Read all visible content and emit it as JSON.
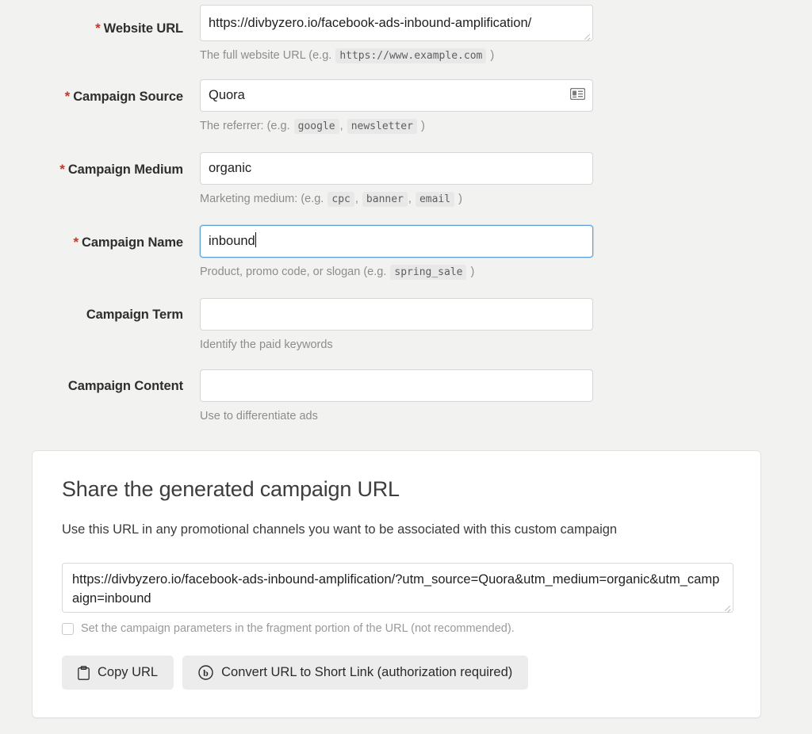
{
  "form": {
    "fields": [
      {
        "id": "website-url",
        "label": "Website URL",
        "required": true,
        "value": "https://divbyzero.io/facebook-ads-inbound-amplification/",
        "help_prefix": "The full website URL (e.g.",
        "help_chips": [
          "https://www.example.com"
        ],
        "help_suffix": ")"
      },
      {
        "id": "campaign-source",
        "label": "Campaign Source",
        "required": true,
        "value": "Quora",
        "help_prefix": "The referrer: (e.g.",
        "help_chips": [
          "google",
          "newsletter"
        ],
        "help_suffix": ")",
        "icon": "contact-card-icon"
      },
      {
        "id": "campaign-medium",
        "label": "Campaign Medium",
        "required": true,
        "value": "organic",
        "help_prefix": "Marketing medium: (e.g.",
        "help_chips": [
          "cpc",
          "banner",
          "email"
        ],
        "help_suffix": ")"
      },
      {
        "id": "campaign-name",
        "label": "Campaign Name",
        "required": true,
        "value": "inbound",
        "focused": true,
        "help_prefix": "Product, promo code, or slogan (e.g.",
        "help_chips": [
          "spring_sale"
        ],
        "help_suffix": ")"
      },
      {
        "id": "campaign-term",
        "label": "Campaign Term",
        "required": false,
        "value": "",
        "help_prefix": "Identify the paid keywords",
        "help_chips": [],
        "help_suffix": ""
      },
      {
        "id": "campaign-content",
        "label": "Campaign Content",
        "required": false,
        "value": "",
        "help_prefix": "Use to differentiate ads",
        "help_chips": [],
        "help_suffix": ""
      }
    ],
    "required_marker": "*"
  },
  "share_card": {
    "title": "Share the generated campaign URL",
    "subtitle": "Use this URL in any promotional channels you want to be associated with this custom campaign",
    "generated_url": "https://divbyzero.io/facebook-ads-inbound-amplification/?utm_source=Quora&utm_medium=organic&utm_campaign=inbound",
    "fragment_checkbox_label": "Set the campaign parameters in the fragment portion of the URL (not recommended).",
    "fragment_checkbox_checked": false,
    "copy_button_label": "Copy URL",
    "shorten_button_label": "Convert URL to Short Link (authorization required)"
  },
  "colors": {
    "page_background": "#f2f2f1",
    "required_star": "#c0392b",
    "focus_border": "#5b9dd9",
    "help_text": "#8d8d8d",
    "button_background": "#ececec"
  }
}
